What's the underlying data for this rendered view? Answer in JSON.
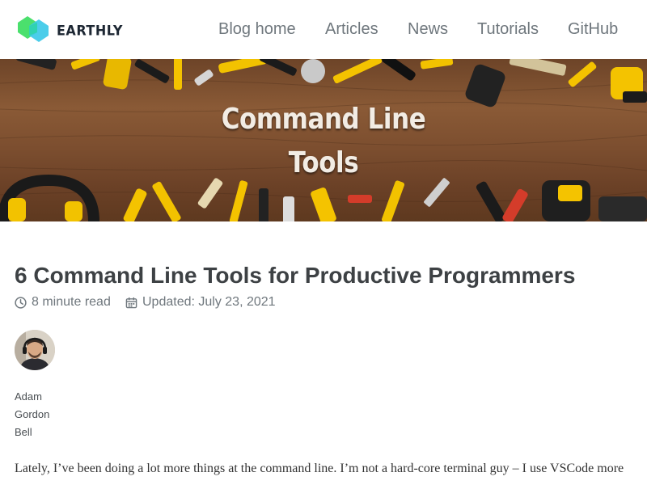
{
  "brand": {
    "name": "EARTHLY"
  },
  "nav": {
    "items": [
      {
        "label": "Blog home"
      },
      {
        "label": "Articles"
      },
      {
        "label": "News"
      },
      {
        "label": "Tutorials"
      },
      {
        "label": "GitHub"
      }
    ]
  },
  "hero": {
    "title_line1": "Command Line",
    "title_line2": "Tools"
  },
  "article": {
    "title": "6 Command Line Tools for Productive Programmers",
    "read_time": "8 minute read",
    "updated": "Updated: July 23, 2021",
    "author": {
      "first": "Adam",
      "middle": "Gordon",
      "last": "Bell"
    },
    "intro": "Lately, I’ve been doing a lot more things at the command line. I’m not a hard-core terminal guy – I use VSCode more"
  },
  "icons": {
    "read_time": "clock-icon",
    "updated": "calendar-icon"
  },
  "colors": {
    "nav_text": "#6f777d",
    "title_text": "#3d4144",
    "logo_green": "#3ddc84",
    "logo_cyan": "#3cc9e8"
  }
}
